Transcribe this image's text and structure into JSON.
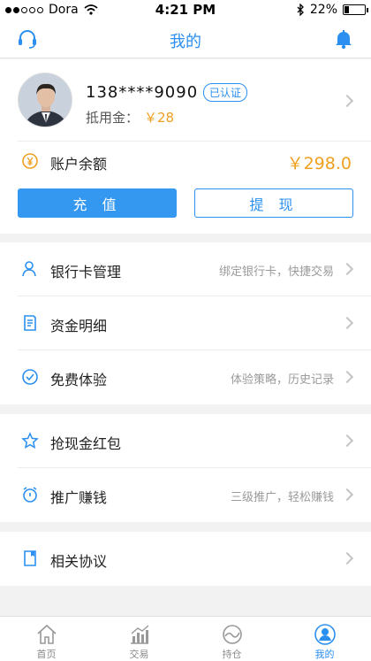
{
  "status_bar": {
    "carrier": "Dora",
    "time": "4:21 PM",
    "battery": "22%",
    "battery_level": 0.22
  },
  "header": {
    "title": "我的"
  },
  "profile": {
    "phone": "138****9090",
    "verified_badge": "已认证",
    "deduct_label": "抵用金：",
    "deduct_amount": "￥28"
  },
  "balance": {
    "label": "账户余额",
    "value": "￥298.0"
  },
  "actions": {
    "charge": "充 值",
    "withdraw": "提 现"
  },
  "menu_group1": [
    {
      "label": "银行卡管理",
      "hint": "绑定银行卡，快捷交易"
    },
    {
      "label": "资金明细",
      "hint": ""
    },
    {
      "label": "免费体验",
      "hint": "体验策略，历史记录"
    }
  ],
  "menu_group2": [
    {
      "label": "抢现金红包",
      "hint": ""
    },
    {
      "label": "推广赚钱",
      "hint": "三级推广，轻松赚钱"
    }
  ],
  "menu_group3": [
    {
      "label": "相关协议",
      "hint": ""
    }
  ],
  "tabs": [
    {
      "label": "首页",
      "icon": "home-icon"
    },
    {
      "label": "交易",
      "icon": "chart-icon"
    },
    {
      "label": "持仓",
      "icon": "position-icon"
    },
    {
      "label": "我的",
      "icon": "user-icon",
      "active": true
    }
  ],
  "colors": {
    "accent": "#2a8ff0",
    "money": "#f0a020"
  }
}
